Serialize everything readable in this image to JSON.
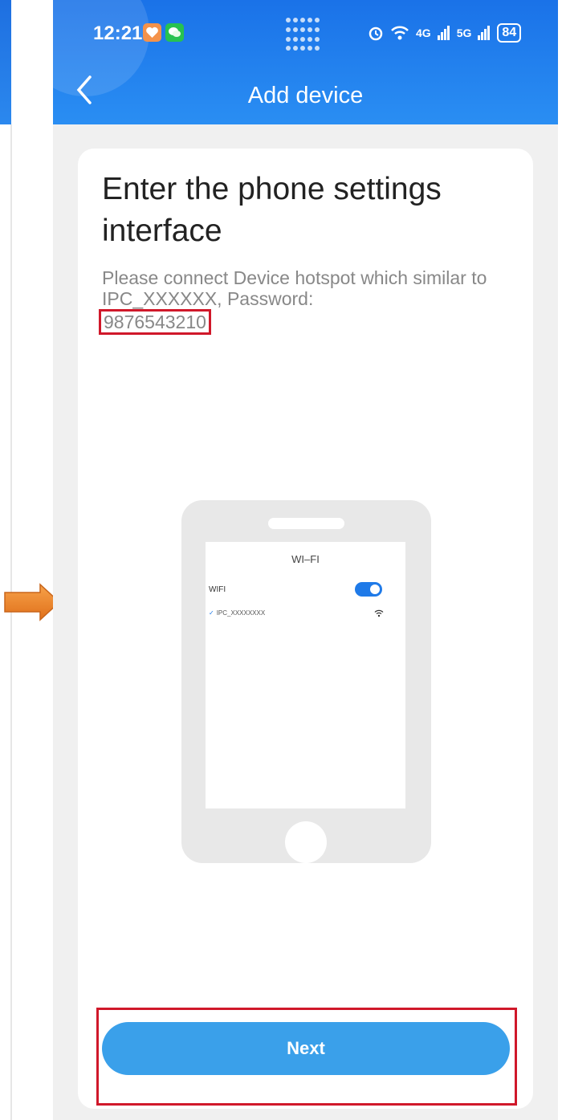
{
  "status_bar": {
    "time": "12:21",
    "signal_4g": "4G",
    "signal_5g": "5G",
    "battery": "84"
  },
  "header": {
    "back_icon": "chevron-left-icon",
    "title": "Add device"
  },
  "content": {
    "heading": "Enter the phone settings interface",
    "instruction": "Please connect Device hotspot which similar to IPC_XXXXXX, Password:",
    "password": "9876543210"
  },
  "illustration": {
    "screen_title": "WI–FI",
    "wifi_label": "WIFI",
    "network_name": "IPC_XXXXXXXX",
    "wifi_toggle_on": true
  },
  "actions": {
    "next_label": "Next"
  },
  "colors": {
    "header": "#1f7ae8",
    "button": "#3aa0ea",
    "highlight": "#d0182a",
    "arrow": "#f0861f"
  }
}
